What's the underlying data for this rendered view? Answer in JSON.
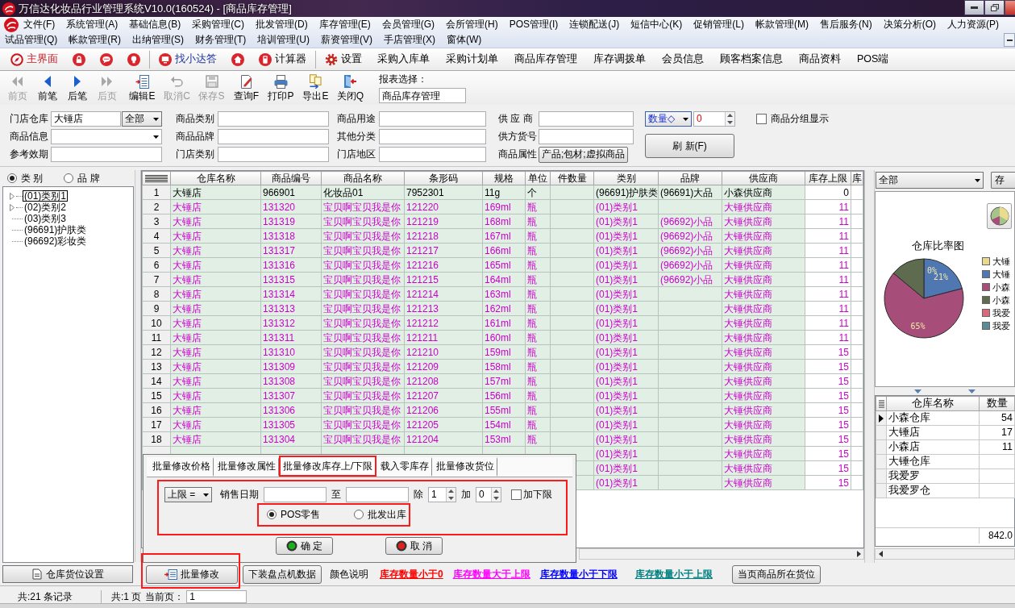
{
  "window": {
    "title": "万信达化妆品行业管理系统V10.0(160524) - [商品库存管理]"
  },
  "menu": {
    "rows": [
      [
        "文件(F)",
        "系统管理(A)",
        "基础信息(B)",
        "采购管理(C)",
        "批发管理(D)",
        "库存管理(E)",
        "会员管理(G)",
        "会所管理(H)",
        "POS管理(I)",
        "连锁配送(J)",
        "短信中心(K)",
        "促销管理(L)",
        "帐款管理(M)",
        "售后服务(N)",
        "决策分析(O)",
        "人力资源(P)"
      ],
      [
        "试品管理(Q)",
        "帐款管理(R)",
        "出纳管理(S)",
        "财务管理(T)",
        "培训管理(U)",
        "薪资管理(V)",
        "手店管理(X)",
        "窗体(W)"
      ]
    ]
  },
  "quick_bar": [
    {
      "kind": "button",
      "label": "主界面"
    },
    {
      "kind": "button"
    },
    {
      "kind": "button"
    },
    {
      "kind": "button"
    },
    {
      "kind": "separator"
    },
    {
      "kind": "button",
      "label": "找小达答"
    },
    {
      "kind": "button"
    },
    {
      "kind": "button",
      "label": "计算器"
    },
    {
      "kind": "separator"
    },
    {
      "kind": "button",
      "label": "设置"
    },
    {
      "kind": "button",
      "label": "采购入库单"
    },
    {
      "kind": "button",
      "label": "采购计划单"
    },
    {
      "kind": "button",
      "label": "商品库存管理"
    },
    {
      "kind": "button",
      "label": "库存调拨单"
    },
    {
      "kind": "button",
      "label": "会员信息"
    },
    {
      "kind": "button",
      "label": "顾客档案信息"
    },
    {
      "kind": "button",
      "label": "商品资料"
    },
    {
      "kind": "button",
      "label": "POS端"
    }
  ],
  "toolbar": {
    "buttons": [
      {
        "label": "前页",
        "disabled": true
      },
      {
        "label": "前笔",
        "disabled": false
      },
      {
        "label": "后笔",
        "disabled": false
      },
      {
        "label": "后页",
        "disabled": true
      },
      {
        "label": "编辑E",
        "disabled": false
      },
      {
        "label": "取消C",
        "disabled": true
      },
      {
        "label": "保存S",
        "disabled": true
      },
      {
        "label": "查询F",
        "disabled": false
      },
      {
        "label": "打印P",
        "disabled": false
      },
      {
        "label": "导出E",
        "disabled": false
      },
      {
        "label": "关闭Q",
        "disabled": false
      }
    ],
    "report_label": "报表选择：",
    "report_value": "商品库存管理"
  },
  "filters": {
    "groups": [
      [
        {
          "label": "门店仓库",
          "kind": "text_select",
          "value": "大锤店",
          "option": "全部"
        },
        {
          "label": "商品信息",
          "kind": "select"
        },
        {
          "label": "参考效期",
          "kind": "text"
        }
      ],
      [
        {
          "label": "商品类别",
          "kind": "text"
        },
        {
          "label": "商品品牌",
          "kind": "text"
        },
        {
          "label": "门店类别",
          "kind": "text"
        }
      ],
      [
        {
          "label": "商品用途",
          "kind": "text"
        },
        {
          "label": "其他分类",
          "kind": "text"
        },
        {
          "label": "门店地区",
          "kind": "text"
        }
      ],
      [
        {
          "label": "供 应 商",
          "kind": "text"
        },
        {
          "label": "供方货号",
          "kind": "text"
        },
        {
          "label": "商品属性",
          "kind": "button",
          "value": "产品;包材;虚拟商品"
        }
      ]
    ],
    "measure_select": "数量◇",
    "measure_value": "0",
    "refresh_button": "刷 新(F)",
    "group_display": {
      "label": "商品分组显示",
      "checked": false
    }
  },
  "tree_panel": {
    "modes": [
      {
        "label": "类 别",
        "selected": true
      },
      {
        "label": "品 牌",
        "selected": false
      }
    ],
    "items": [
      {
        "label": "(01)类别1",
        "selected": true,
        "expandable": true
      },
      {
        "label": "(02)类别2",
        "selected": false,
        "expandable": true
      },
      {
        "label": "(03)类别3",
        "selected": false,
        "expandable": false
      },
      {
        "label": "(96691)护肤类",
        "selected": false,
        "expandable": false
      },
      {
        "label": "(96692)彩妆类",
        "selected": false,
        "expandable": false
      }
    ],
    "button": "仓库货位设置"
  },
  "table": {
    "columns": [
      "仓库名称",
      "商品编号",
      "商品名称",
      "条形码",
      "规格",
      "单位",
      "件数量",
      "类别",
      "品牌",
      "供应商",
      "库存上限",
      "库"
    ],
    "rows": [
      {
        "number": "1",
        "above_limit": false,
        "cells": [
          "大锤店",
          "966901",
          "化妆品01",
          "7952301",
          "11g",
          "个",
          null,
          "(96691)护肤类",
          "(96691)大品",
          "小森供应商",
          "0",
          null
        ]
      },
      {
        "number": "2",
        "above_limit": true,
        "cells": [
          "大锤店",
          "131320",
          "宝贝啊宝贝我是你",
          "121220",
          "169ml",
          "瓶",
          null,
          "(01)类别1",
          null,
          "大锤供应商",
          "11",
          null
        ]
      },
      {
        "number": "3",
        "above_limit": true,
        "cells": [
          "大锤店",
          "131319",
          "宝贝啊宝贝我是你",
          "121219",
          "168ml",
          "瓶",
          null,
          "(01)类别1",
          "(96692)小品",
          "大锤供应商",
          "11",
          null
        ]
      },
      {
        "number": "4",
        "above_limit": true,
        "cells": [
          "大锤店",
          "131318",
          "宝贝啊宝贝我是你",
          "121218",
          "167ml",
          "瓶",
          null,
          "(01)类别1",
          "(96692)小品",
          "大锤供应商",
          "11",
          null
        ]
      },
      {
        "number": "5",
        "above_limit": true,
        "cells": [
          "大锤店",
          "131317",
          "宝贝啊宝贝我是你",
          "121217",
          "166ml",
          "瓶",
          null,
          "(01)类别1",
          "(96692)小品",
          "大锤供应商",
          "11",
          null
        ]
      },
      {
        "number": "6",
        "above_limit": true,
        "cells": [
          "大锤店",
          "131316",
          "宝贝啊宝贝我是你",
          "121216",
          "165ml",
          "瓶",
          null,
          "(01)类别1",
          "(96692)小品",
          "大锤供应商",
          "11",
          null
        ]
      },
      {
        "number": "7",
        "above_limit": true,
        "cells": [
          "大锤店",
          "131315",
          "宝贝啊宝贝我是你",
          "121215",
          "164ml",
          "瓶",
          null,
          "(01)类别1",
          "(96692)小品",
          "大锤供应商",
          "11",
          null
        ]
      },
      {
        "number": "8",
        "above_limit": true,
        "cells": [
          "大锤店",
          "131314",
          "宝贝啊宝贝我是你",
          "121214",
          "163ml",
          "瓶",
          null,
          "(01)类别1",
          null,
          "大锤供应商",
          "11",
          null
        ]
      },
      {
        "number": "9",
        "above_limit": true,
        "cells": [
          "大锤店",
          "131313",
          "宝贝啊宝贝我是你",
          "121213",
          "162ml",
          "瓶",
          null,
          "(01)类别1",
          null,
          "大锤供应商",
          "11",
          null
        ]
      },
      {
        "number": "10",
        "above_limit": true,
        "cells": [
          "大锤店",
          "131312",
          "宝贝啊宝贝我是你",
          "121212",
          "161ml",
          "瓶",
          null,
          "(01)类别1",
          null,
          "大锤供应商",
          "11",
          null
        ]
      },
      {
        "number": "11",
        "above_limit": true,
        "cells": [
          "大锤店",
          "131311",
          "宝贝啊宝贝我是你",
          "121211",
          "160ml",
          "瓶",
          null,
          "(01)类别1",
          null,
          "大锤供应商",
          "11",
          null
        ]
      },
      {
        "number": "12",
        "above_limit": true,
        "cells": [
          "大锤店",
          "131310",
          "宝贝啊宝贝我是你",
          "121210",
          "159ml",
          "瓶",
          null,
          "(01)类别1",
          null,
          "大锤供应商",
          "15",
          null
        ]
      },
      {
        "number": "13",
        "above_limit": true,
        "cells": [
          "大锤店",
          "131309",
          "宝贝啊宝贝我是你",
          "121209",
          "158ml",
          "瓶",
          null,
          "(01)类别1",
          null,
          "大锤供应商",
          "15",
          null
        ]
      },
      {
        "number": "14",
        "above_limit": true,
        "cells": [
          "大锤店",
          "131308",
          "宝贝啊宝贝我是你",
          "121208",
          "157ml",
          "瓶",
          null,
          "(01)类别1",
          null,
          "大锤供应商",
          "15",
          null
        ]
      },
      {
        "number": "15",
        "above_limit": true,
        "cells": [
          "大锤店",
          "131307",
          "宝贝啊宝贝我是你",
          "121207",
          "156ml",
          "瓶",
          null,
          "(01)类别1",
          null,
          "大锤供应商",
          "15",
          null
        ]
      },
      {
        "number": "16",
        "above_limit": true,
        "cells": [
          "大锤店",
          "131306",
          "宝贝啊宝贝我是你",
          "121206",
          "155ml",
          "瓶",
          null,
          "(01)类别1",
          null,
          "大锤供应商",
          "15",
          null
        ]
      },
      {
        "number": "17",
        "above_limit": true,
        "cells": [
          "大锤店",
          "131305",
          "宝贝啊宝贝我是你",
          "121205",
          "154ml",
          "瓶",
          null,
          "(01)类别1",
          null,
          "大锤供应商",
          "15",
          null
        ]
      },
      {
        "number": "18",
        "above_limit": true,
        "cells": [
          "大锤店",
          "131304",
          "宝贝啊宝贝我是你",
          "121204",
          "153ml",
          "瓶",
          null,
          "(01)类别1",
          null,
          "大锤供应商",
          "15",
          null
        ]
      },
      {
        "above_limit": true,
        "cells": [
          null,
          null,
          null,
          null,
          null,
          null,
          null,
          "(01)类别1",
          null,
          "大锤供应商",
          "15",
          null
        ]
      },
      {
        "above_limit": true,
        "cells": [
          null,
          null,
          null,
          null,
          null,
          null,
          null,
          "(01)类别1",
          null,
          "大锤供应商",
          "15",
          null
        ]
      },
      {
        "above_limit": true,
        "cells": [
          null,
          null,
          null,
          null,
          null,
          null,
          null,
          "(01)类别1",
          null,
          "大锤供应商",
          "15",
          null
        ]
      }
    ]
  },
  "batch_panel": {
    "tabs": [
      {
        "label": "批量修改价格",
        "selected": false,
        "highlighted": false
      },
      {
        "label": "批量修改属性",
        "selected": false,
        "highlighted": false
      },
      {
        "label": "批量修改库存上/下限",
        "selected": true,
        "highlighted": true
      },
      {
        "label": "载入零库存",
        "selected": false,
        "highlighted": false
      },
      {
        "label": "批量修改货位",
        "selected": false,
        "highlighted": false
      }
    ],
    "form": {
      "highlighted": true,
      "limit_select": "上限 =",
      "date_label": "销售日期",
      "to_label": "至",
      "divide_label": "除",
      "divide_value": "1",
      "add_label": "加",
      "add_value": "0",
      "lower_limit": {
        "label": "加下限",
        "checked": false
      }
    },
    "sources": {
      "highlighted": true,
      "options": [
        {
          "label": "POS零售",
          "selected": true
        },
        {
          "label": "批发出库",
          "selected": false
        }
      ]
    },
    "buttons": [
      {
        "label": "确 定",
        "kind": "confirm"
      },
      {
        "label": "取 消",
        "kind": "cancel"
      }
    ]
  },
  "bottom_bar": {
    "actions": [
      {
        "kind": "button",
        "label": "批量修改",
        "highlighted": true
      },
      {
        "kind": "button",
        "label": "下装盘点机数据",
        "highlighted": false
      },
      {
        "kind": "label",
        "label": "颜色说明"
      },
      {
        "kind": "legend",
        "label": "库存数量小于0",
        "color": "#ff0000"
      },
      {
        "kind": "legend",
        "label": "库存数量大于上限",
        "color": "#ff00ff"
      },
      {
        "kind": "legend",
        "label": "库存数量小于下限",
        "color": "#0000ff"
      },
      {
        "kind": "legend",
        "label": "库存数量小于上限",
        "color": "#008080"
      },
      {
        "kind": "button",
        "label": "当页商品所在货位",
        "highlighted": false
      }
    ]
  },
  "side_panel": {
    "scope_select": "全部",
    "side_button": "存",
    "chart": {
      "chart_data": {
        "type": "pie",
        "title": "仓库比率图",
        "categories": [
          "大锤",
          "大锤",
          "小森",
          "小森",
          "我爱",
          "我爱"
        ],
        "values": [
          0,
          21,
          65,
          14,
          0,
          0
        ],
        "value_labels": [
          "0%",
          "21%",
          "65%",
          null,
          null,
          null
        ]
      },
      "legend": [
        {
          "color": "#e9d98f"
        },
        {
          "color": "#4f78b3"
        },
        {
          "color": "#a64d79"
        },
        {
          "color": "#5e6b4f"
        },
        {
          "color": "#d9697a"
        },
        {
          "color": "#5b8c96"
        }
      ]
    },
    "summary": {
      "columns": [
        "仓库名称",
        "数量"
      ],
      "rows": [
        {
          "name": "小森仓库",
          "quantity": "54",
          "current": true
        },
        {
          "name": "大锤店",
          "quantity": "17",
          "current": false
        },
        {
          "name": "小森店",
          "quantity": "11",
          "current": false
        },
        {
          "name": "大锤仓库",
          "current": false
        },
        {
          "name": "我爱罗",
          "current": false
        },
        {
          "name": "我爱罗仓",
          "current": false
        }
      ],
      "total": "842.0"
    }
  },
  "status_bar": {
    "records": "共:21 条记录",
    "pages": "共:1 页",
    "page_label": "当前页：",
    "page_value": "1"
  }
}
